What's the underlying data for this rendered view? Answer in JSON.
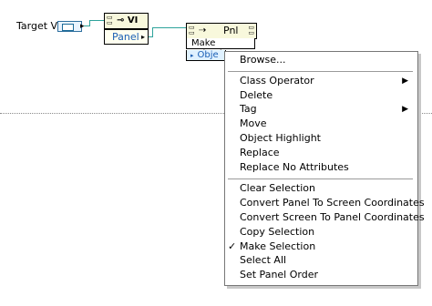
{
  "diagram": {
    "terminal_label": "Target VI",
    "property_node": {
      "header_icon": "vi-reference-icon",
      "header_text": "VI",
      "property_label": "Panel"
    },
    "invoke_node": {
      "header_icon": "panel-reference-icon",
      "arrow": "method-invoke-arrow",
      "header_text": "Pnl",
      "method_label": "Make Selection",
      "param_label": "Obje"
    }
  },
  "context_menu": {
    "items": [
      {
        "label": "Browse...",
        "submenu": false,
        "checked": false
      },
      {
        "label": "Class Operator",
        "submenu": true,
        "checked": false
      },
      {
        "label": "Delete",
        "submenu": false,
        "checked": false
      },
      {
        "label": "Tag",
        "submenu": true,
        "checked": false
      },
      {
        "label": "Move",
        "submenu": false,
        "checked": false
      },
      {
        "label": "Object Highlight",
        "submenu": false,
        "checked": false
      },
      {
        "label": "Replace",
        "submenu": false,
        "checked": false
      },
      {
        "label": "Replace No Attributes",
        "submenu": false,
        "checked": false
      },
      {
        "label": "Clear Selection",
        "submenu": false,
        "checked": false
      },
      {
        "label": "Convert Panel To Screen Coordinates",
        "submenu": false,
        "checked": false
      },
      {
        "label": "Convert Screen To Panel Coordinates",
        "submenu": false,
        "checked": false
      },
      {
        "label": "Copy Selection",
        "submenu": false,
        "checked": false
      },
      {
        "label": "Make Selection",
        "submenu": false,
        "checked": true
      },
      {
        "label": "Select All",
        "submenu": false,
        "checked": false
      },
      {
        "label": "Set Panel Order",
        "submenu": false,
        "checked": false
      }
    ]
  },
  "colors": {
    "wire": "#2ea39b",
    "node_header": "#f8f8dc",
    "reference_text": "#1a5fb4"
  }
}
